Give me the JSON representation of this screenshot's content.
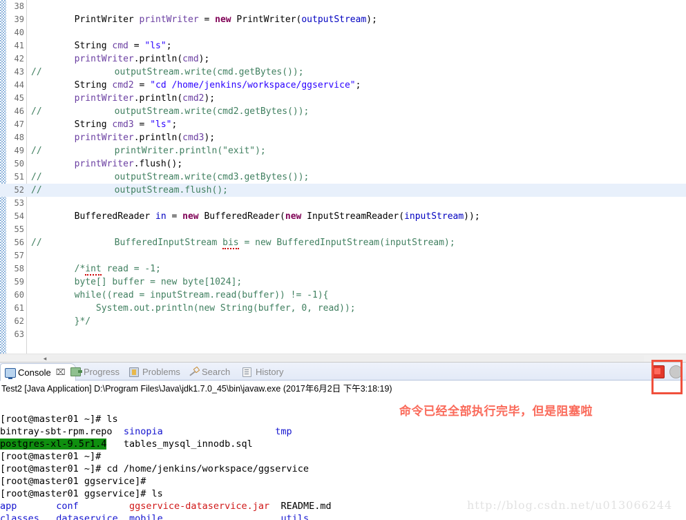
{
  "editor": {
    "first_line": 38,
    "highlighted_line": 52,
    "lines": [
      {
        "n": 38,
        "segments": []
      },
      {
        "n": 39,
        "segments": [
          {
            "t": "        ",
            "c": "pln"
          },
          {
            "t": "PrintWriter",
            "c": "pln"
          },
          {
            "t": " ",
            "c": "pln"
          },
          {
            "t": "printWriter",
            "c": "loc"
          },
          {
            "t": " = ",
            "c": "pln"
          },
          {
            "t": "new",
            "c": "kw"
          },
          {
            "t": " PrintWriter(",
            "c": "pln"
          },
          {
            "t": "outputStream",
            "c": "var"
          },
          {
            "t": ");",
            "c": "pln"
          }
        ]
      },
      {
        "n": 40,
        "segments": []
      },
      {
        "n": 41,
        "segments": [
          {
            "t": "        String ",
            "c": "pln"
          },
          {
            "t": "cmd",
            "c": "loc"
          },
          {
            "t": " = ",
            "c": "pln"
          },
          {
            "t": "\"ls\"",
            "c": "str"
          },
          {
            "t": ";",
            "c": "pln"
          }
        ]
      },
      {
        "n": 42,
        "segments": [
          {
            "t": "        ",
            "c": "pln"
          },
          {
            "t": "printWriter",
            "c": "loc"
          },
          {
            "t": ".println(",
            "c": "pln"
          },
          {
            "t": "cmd",
            "c": "loc"
          },
          {
            "t": ");",
            "c": "pln"
          }
        ]
      },
      {
        "n": 43,
        "segments": [
          {
            "t": "//",
            "c": "cmt",
            "gutter": true
          },
          {
            "t": "        outputStream.write(cmd.getBytes());",
            "c": "cmt"
          }
        ]
      },
      {
        "n": 44,
        "segments": [
          {
            "t": "        String ",
            "c": "pln"
          },
          {
            "t": "cmd2",
            "c": "loc"
          },
          {
            "t": " = ",
            "c": "pln"
          },
          {
            "t": "\"cd /home/jenkins/workspace/ggservice\"",
            "c": "str"
          },
          {
            "t": ";",
            "c": "pln"
          }
        ]
      },
      {
        "n": 45,
        "segments": [
          {
            "t": "        ",
            "c": "pln"
          },
          {
            "t": "printWriter",
            "c": "loc"
          },
          {
            "t": ".println(",
            "c": "pln"
          },
          {
            "t": "cmd2",
            "c": "loc"
          },
          {
            "t": ");",
            "c": "pln"
          }
        ]
      },
      {
        "n": 46,
        "segments": [
          {
            "t": "//",
            "c": "cmt",
            "gutter": true
          },
          {
            "t": "        outputStream.write(cmd2.getBytes());",
            "c": "cmt"
          }
        ]
      },
      {
        "n": 47,
        "segments": [
          {
            "t": "        String ",
            "c": "pln"
          },
          {
            "t": "cmd3",
            "c": "loc"
          },
          {
            "t": " = ",
            "c": "pln"
          },
          {
            "t": "\"ls\"",
            "c": "str"
          },
          {
            "t": ";",
            "c": "pln"
          }
        ]
      },
      {
        "n": 48,
        "segments": [
          {
            "t": "        ",
            "c": "pln"
          },
          {
            "t": "printWriter",
            "c": "loc"
          },
          {
            "t": ".println(",
            "c": "pln"
          },
          {
            "t": "cmd3",
            "c": "loc"
          },
          {
            "t": ");",
            "c": "pln"
          }
        ]
      },
      {
        "n": 49,
        "segments": [
          {
            "t": "//",
            "c": "cmt",
            "gutter": true
          },
          {
            "t": "        printWriter.println(\"exit\");",
            "c": "cmt"
          }
        ]
      },
      {
        "n": 50,
        "segments": [
          {
            "t": "        ",
            "c": "pln"
          },
          {
            "t": "printWriter",
            "c": "loc"
          },
          {
            "t": ".flush();",
            "c": "pln"
          }
        ]
      },
      {
        "n": 51,
        "segments": [
          {
            "t": "//",
            "c": "cmt",
            "gutter": true
          },
          {
            "t": "        outputStream.write(cmd3.getBytes());",
            "c": "cmt"
          }
        ]
      },
      {
        "n": 52,
        "segments": [
          {
            "t": "//",
            "c": "cmt",
            "gutter": true
          },
          {
            "t": "        outputStream.flush();",
            "c": "cmt"
          }
        ]
      },
      {
        "n": 53,
        "segments": []
      },
      {
        "n": 54,
        "segments": [
          {
            "t": "        BufferedReader ",
            "c": "pln"
          },
          {
            "t": "in",
            "c": "var"
          },
          {
            "t": " = ",
            "c": "pln"
          },
          {
            "t": "new",
            "c": "kw"
          },
          {
            "t": " BufferedReader(",
            "c": "pln"
          },
          {
            "t": "new",
            "c": "kw"
          },
          {
            "t": " InputStreamReader(",
            "c": "pln"
          },
          {
            "t": "inputStream",
            "c": "var"
          },
          {
            "t": "));",
            "c": "pln"
          }
        ]
      },
      {
        "n": 55,
        "segments": []
      },
      {
        "n": 56,
        "segments": [
          {
            "t": "//",
            "c": "cmt",
            "gutter": true
          },
          {
            "t": "        BufferedInputStream ",
            "c": "cmt"
          },
          {
            "t": "bis",
            "c": "cmt",
            "squiggle": true
          },
          {
            "t": " = new BufferedInputStream(inputStream);",
            "c": "cmt"
          }
        ]
      },
      {
        "n": 57,
        "segments": []
      },
      {
        "n": 58,
        "segments": [
          {
            "t": "        /*",
            "c": "cmt"
          },
          {
            "t": "int",
            "c": "cmt",
            "squiggle": true
          },
          {
            "t": " read = -1;",
            "c": "cmt"
          }
        ]
      },
      {
        "n": 59,
        "segments": [
          {
            "t": "        byte[] buffer = new byte[1024];",
            "c": "cmt"
          }
        ]
      },
      {
        "n": 60,
        "segments": [
          {
            "t": "        while((read = inputStream.read(buffer)) != -1){",
            "c": "cmt"
          }
        ]
      },
      {
        "n": 61,
        "segments": [
          {
            "t": "            System.out.println(new String(buffer, 0, read));",
            "c": "cmt"
          }
        ]
      },
      {
        "n": 62,
        "segments": [
          {
            "t": "        }*/",
            "c": "cmt"
          }
        ]
      },
      {
        "n": 63,
        "segments": []
      }
    ]
  },
  "console_view": {
    "tabs": [
      {
        "label": "Console",
        "icon": "monitor-icon",
        "active": true,
        "closable": true
      },
      {
        "label": "Progress",
        "icon": "progress-icon",
        "active": false,
        "closable": false
      },
      {
        "label": "Problems",
        "icon": "problems-icon",
        "active": false,
        "closable": false
      },
      {
        "label": "Search",
        "icon": "search-icon",
        "active": false,
        "closable": false
      },
      {
        "label": "History",
        "icon": "history-icon",
        "active": false,
        "closable": false
      }
    ],
    "toolbar": {
      "terminate_label": "terminate-icon",
      "secondary_label": "remove-launch-icon"
    },
    "run_info": "Test2 [Java Application] D:\\Program Files\\Java\\jdk1.7.0_45\\bin\\javaw.exe (2017年6月2日 下午3:18:19)",
    "annotation": "命令已经全部执行完毕，但是阻塞啦",
    "annotation_color": "#fa6a5a",
    "highlight_box_color": "#f0503c",
    "output": [
      [
        {
          "t": "[root@master01 ~]# ls",
          "c": "black"
        }
      ],
      [
        {
          "t": "bintray-sbt-rpm.repo  ",
          "c": "black"
        },
        {
          "t": "sinopia",
          "c": "blue"
        },
        {
          "t": "                    ",
          "c": "black"
        },
        {
          "t": "tmp",
          "c": "blue"
        }
      ],
      [
        {
          "t": "postgres-xl-9.5r1.4",
          "c": "green"
        },
        {
          "t": "   tables_mysql_innodb.sql",
          "c": "black"
        }
      ],
      [
        {
          "t": "[root@master01 ~]#",
          "c": "black"
        }
      ],
      [
        {
          "t": "[root@master01 ~]# cd /home/jenkins/workspace/ggservice",
          "c": "black"
        }
      ],
      [
        {
          "t": "[root@master01 ggservice]#",
          "c": "black"
        }
      ],
      [
        {
          "t": "[root@master01 ggservice]# ls",
          "c": "black"
        }
      ],
      [
        {
          "t": "app",
          "c": "blue"
        },
        {
          "t": "       ",
          "c": "black"
        },
        {
          "t": "conf",
          "c": "blue"
        },
        {
          "t": "         ",
          "c": "black"
        },
        {
          "t": "ggservice-dataservice.jar",
          "c": "red"
        },
        {
          "t": "  ",
          "c": "black"
        },
        {
          "t": "README.md",
          "c": "black"
        }
      ],
      [
        {
          "t": "classes",
          "c": "blue"
        },
        {
          "t": "   ",
          "c": "black"
        },
        {
          "t": "dataservice",
          "c": "blue"
        },
        {
          "t": "  ",
          "c": "black"
        },
        {
          "t": "mobile",
          "c": "blue"
        },
        {
          "t": "                     ",
          "c": "black"
        },
        {
          "t": "utils",
          "c": "blue"
        }
      ]
    ]
  },
  "watermark": "http://blog.csdn.net/u013066244"
}
